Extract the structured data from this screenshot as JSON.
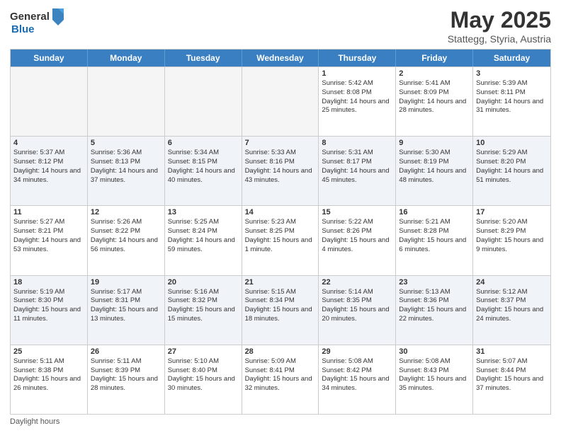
{
  "logo": {
    "general": "General",
    "blue": "Blue"
  },
  "title": "May 2025",
  "subtitle": "Stattegg, Styria, Austria",
  "days": [
    "Sunday",
    "Monday",
    "Tuesday",
    "Wednesday",
    "Thursday",
    "Friday",
    "Saturday"
  ],
  "footer": "Daylight hours",
  "weeks": [
    [
      {
        "day": "",
        "sunrise": "",
        "sunset": "",
        "daylight": "",
        "empty": true
      },
      {
        "day": "",
        "sunrise": "",
        "sunset": "",
        "daylight": "",
        "empty": true
      },
      {
        "day": "",
        "sunrise": "",
        "sunset": "",
        "daylight": "",
        "empty": true
      },
      {
        "day": "",
        "sunrise": "",
        "sunset": "",
        "daylight": "",
        "empty": true
      },
      {
        "day": "1",
        "sunrise": "Sunrise: 5:42 AM",
        "sunset": "Sunset: 8:08 PM",
        "daylight": "Daylight: 14 hours and 25 minutes."
      },
      {
        "day": "2",
        "sunrise": "Sunrise: 5:41 AM",
        "sunset": "Sunset: 8:09 PM",
        "daylight": "Daylight: 14 hours and 28 minutes."
      },
      {
        "day": "3",
        "sunrise": "Sunrise: 5:39 AM",
        "sunset": "Sunset: 8:11 PM",
        "daylight": "Daylight: 14 hours and 31 minutes."
      }
    ],
    [
      {
        "day": "4",
        "sunrise": "Sunrise: 5:37 AM",
        "sunset": "Sunset: 8:12 PM",
        "daylight": "Daylight: 14 hours and 34 minutes."
      },
      {
        "day": "5",
        "sunrise": "Sunrise: 5:36 AM",
        "sunset": "Sunset: 8:13 PM",
        "daylight": "Daylight: 14 hours and 37 minutes."
      },
      {
        "day": "6",
        "sunrise": "Sunrise: 5:34 AM",
        "sunset": "Sunset: 8:15 PM",
        "daylight": "Daylight: 14 hours and 40 minutes."
      },
      {
        "day": "7",
        "sunrise": "Sunrise: 5:33 AM",
        "sunset": "Sunset: 8:16 PM",
        "daylight": "Daylight: 14 hours and 43 minutes."
      },
      {
        "day": "8",
        "sunrise": "Sunrise: 5:31 AM",
        "sunset": "Sunset: 8:17 PM",
        "daylight": "Daylight: 14 hours and 45 minutes."
      },
      {
        "day": "9",
        "sunrise": "Sunrise: 5:30 AM",
        "sunset": "Sunset: 8:19 PM",
        "daylight": "Daylight: 14 hours and 48 minutes."
      },
      {
        "day": "10",
        "sunrise": "Sunrise: 5:29 AM",
        "sunset": "Sunset: 8:20 PM",
        "daylight": "Daylight: 14 hours and 51 minutes."
      }
    ],
    [
      {
        "day": "11",
        "sunrise": "Sunrise: 5:27 AM",
        "sunset": "Sunset: 8:21 PM",
        "daylight": "Daylight: 14 hours and 53 minutes."
      },
      {
        "day": "12",
        "sunrise": "Sunrise: 5:26 AM",
        "sunset": "Sunset: 8:22 PM",
        "daylight": "Daylight: 14 hours and 56 minutes."
      },
      {
        "day": "13",
        "sunrise": "Sunrise: 5:25 AM",
        "sunset": "Sunset: 8:24 PM",
        "daylight": "Daylight: 14 hours and 59 minutes."
      },
      {
        "day": "14",
        "sunrise": "Sunrise: 5:23 AM",
        "sunset": "Sunset: 8:25 PM",
        "daylight": "Daylight: 15 hours and 1 minute."
      },
      {
        "day": "15",
        "sunrise": "Sunrise: 5:22 AM",
        "sunset": "Sunset: 8:26 PM",
        "daylight": "Daylight: 15 hours and 4 minutes."
      },
      {
        "day": "16",
        "sunrise": "Sunrise: 5:21 AM",
        "sunset": "Sunset: 8:28 PM",
        "daylight": "Daylight: 15 hours and 6 minutes."
      },
      {
        "day": "17",
        "sunrise": "Sunrise: 5:20 AM",
        "sunset": "Sunset: 8:29 PM",
        "daylight": "Daylight: 15 hours and 9 minutes."
      }
    ],
    [
      {
        "day": "18",
        "sunrise": "Sunrise: 5:19 AM",
        "sunset": "Sunset: 8:30 PM",
        "daylight": "Daylight: 15 hours and 11 minutes."
      },
      {
        "day": "19",
        "sunrise": "Sunrise: 5:17 AM",
        "sunset": "Sunset: 8:31 PM",
        "daylight": "Daylight: 15 hours and 13 minutes."
      },
      {
        "day": "20",
        "sunrise": "Sunrise: 5:16 AM",
        "sunset": "Sunset: 8:32 PM",
        "daylight": "Daylight: 15 hours and 15 minutes."
      },
      {
        "day": "21",
        "sunrise": "Sunrise: 5:15 AM",
        "sunset": "Sunset: 8:34 PM",
        "daylight": "Daylight: 15 hours and 18 minutes."
      },
      {
        "day": "22",
        "sunrise": "Sunrise: 5:14 AM",
        "sunset": "Sunset: 8:35 PM",
        "daylight": "Daylight: 15 hours and 20 minutes."
      },
      {
        "day": "23",
        "sunrise": "Sunrise: 5:13 AM",
        "sunset": "Sunset: 8:36 PM",
        "daylight": "Daylight: 15 hours and 22 minutes."
      },
      {
        "day": "24",
        "sunrise": "Sunrise: 5:12 AM",
        "sunset": "Sunset: 8:37 PM",
        "daylight": "Daylight: 15 hours and 24 minutes."
      }
    ],
    [
      {
        "day": "25",
        "sunrise": "Sunrise: 5:11 AM",
        "sunset": "Sunset: 8:38 PM",
        "daylight": "Daylight: 15 hours and 26 minutes."
      },
      {
        "day": "26",
        "sunrise": "Sunrise: 5:11 AM",
        "sunset": "Sunset: 8:39 PM",
        "daylight": "Daylight: 15 hours and 28 minutes."
      },
      {
        "day": "27",
        "sunrise": "Sunrise: 5:10 AM",
        "sunset": "Sunset: 8:40 PM",
        "daylight": "Daylight: 15 hours and 30 minutes."
      },
      {
        "day": "28",
        "sunrise": "Sunrise: 5:09 AM",
        "sunset": "Sunset: 8:41 PM",
        "daylight": "Daylight: 15 hours and 32 minutes."
      },
      {
        "day": "29",
        "sunrise": "Sunrise: 5:08 AM",
        "sunset": "Sunset: 8:42 PM",
        "daylight": "Daylight: 15 hours and 34 minutes."
      },
      {
        "day": "30",
        "sunrise": "Sunrise: 5:08 AM",
        "sunset": "Sunset: 8:43 PM",
        "daylight": "Daylight: 15 hours and 35 minutes."
      },
      {
        "day": "31",
        "sunrise": "Sunrise: 5:07 AM",
        "sunset": "Sunset: 8:44 PM",
        "daylight": "Daylight: 15 hours and 37 minutes."
      }
    ]
  ]
}
